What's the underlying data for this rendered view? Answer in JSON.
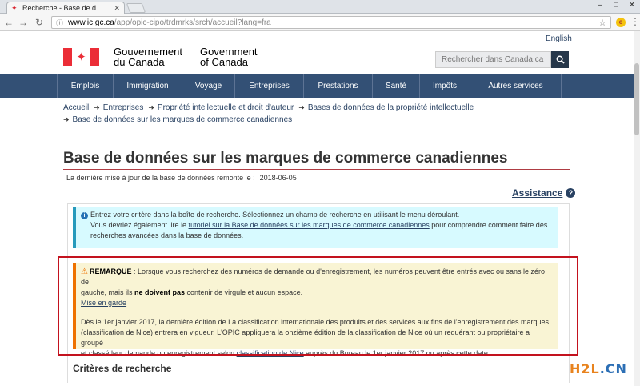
{
  "browser": {
    "tab_title": "Recherche - Base de d",
    "url_host": "www.ic.gc.ca",
    "url_path": "/app/opic-cipo/trdmrks/srch/accueil?lang=fra"
  },
  "header": {
    "lang_toggle": "English",
    "signature_fr_1": "Gouvernement",
    "signature_fr_2": "du Canada",
    "signature_en_1": "Government",
    "signature_en_2": "of Canada",
    "search_placeholder": "Rechercher dans Canada.ca"
  },
  "nav": {
    "items": [
      {
        "label": "Emplois"
      },
      {
        "label": "Immigration"
      },
      {
        "label": "Voyage"
      },
      {
        "label": "Entreprises"
      },
      {
        "label": "Prestations"
      },
      {
        "label": "Santé"
      },
      {
        "label": "Impôts"
      },
      {
        "label": "Autres services"
      }
    ]
  },
  "breadcrumb": {
    "items": [
      {
        "label": "Accueil"
      },
      {
        "label": "Entreprises"
      },
      {
        "label": "Propriété intellectuelle et droit d'auteur"
      },
      {
        "label": "Bases de données de la propriété intellectuelle"
      },
      {
        "label": "Base de données sur les marques de commerce canadiennes"
      }
    ]
  },
  "main": {
    "title": "Base de données sur les marques de commerce canadiennes",
    "last_update_label": "La dernière mise à jour de la base de données remonte le :",
    "last_update_date": "2018-06-05",
    "assistance_label": "Assistance",
    "info": {
      "line1": "Entrez votre critère dans la boîte de recherche. Sélectionnez un champ de recherche en utilisant le menu déroulant.",
      "line2_pre": "Vous devriez également lire le ",
      "line2_link": "tutoriel sur la Base de données sur les marques de commerce canadiennes",
      "line2_post": " pour comprendre comment faire des",
      "line3": "recherches avancées dans la base de données."
    },
    "warning": {
      "label": "REMARQUE",
      "text1": " : Lorsque vous recherchez des numéros de demande ou d'enregistrement, les numéros peuvent être entrés avec ou sans le zéro de",
      "text2_pre": "gauche, mais ils ",
      "text2_bold": "ne doivent pas",
      "text2_post": " contenir de virgule et aucun espace.",
      "mise_en_garde": "Mise en garde",
      "para2_line1": "Dès le 1er janvier 2017, la dernière édition de La classification internationale des produits et des services aux fins de l'enregistrement des marques",
      "para2_line2": "(classification de Nice) entrera en vigueur. L'OPIC appliquera la onzième édition de la classification de Nice où un requérant ou propriétaire a groupé",
      "para2_line3_pre": "et classé leur demande ou enregistrement selon ",
      "para2_line3_link": "classification de Nice",
      "para2_line3_post": " auprès du Bureau le 1er janvier 2017 ou après cette date."
    },
    "criteria_heading": "Critères de recherche"
  },
  "watermark": {
    "part1": "H2L",
    "part2": ".CN"
  }
}
